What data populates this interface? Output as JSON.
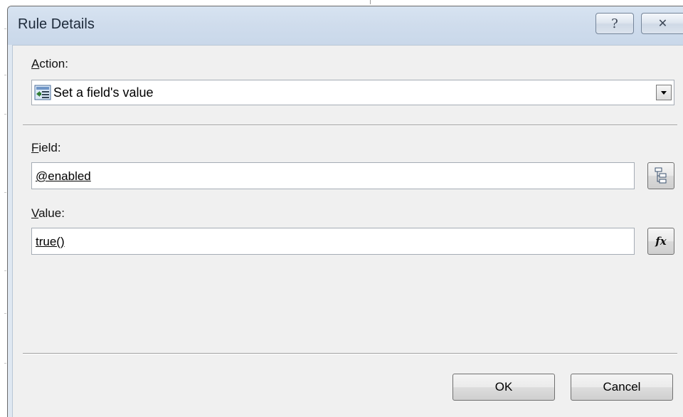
{
  "dialog": {
    "title": "Rule Details",
    "help_glyph": "?",
    "close_glyph": "✕"
  },
  "action": {
    "label_mnemonic": "A",
    "label_rest": "ction:",
    "selected_value": "Set a field's value",
    "icon": "set-field-value-icon"
  },
  "field": {
    "label_mnemonic": "F",
    "label_rest": "ield:",
    "value": "@enabled",
    "picker_icon": "tree-view-icon"
  },
  "value": {
    "label_mnemonic": "V",
    "label_rest": "alue:",
    "value": "true()",
    "formula_icon": "function-fx-icon",
    "formula_glyph": "fx"
  },
  "buttons": {
    "ok": "OK",
    "cancel": "Cancel"
  },
  "colors": {
    "titlebar": "#cfdcec",
    "client": "#f0f0f0",
    "frame": "#6b6b6b"
  }
}
